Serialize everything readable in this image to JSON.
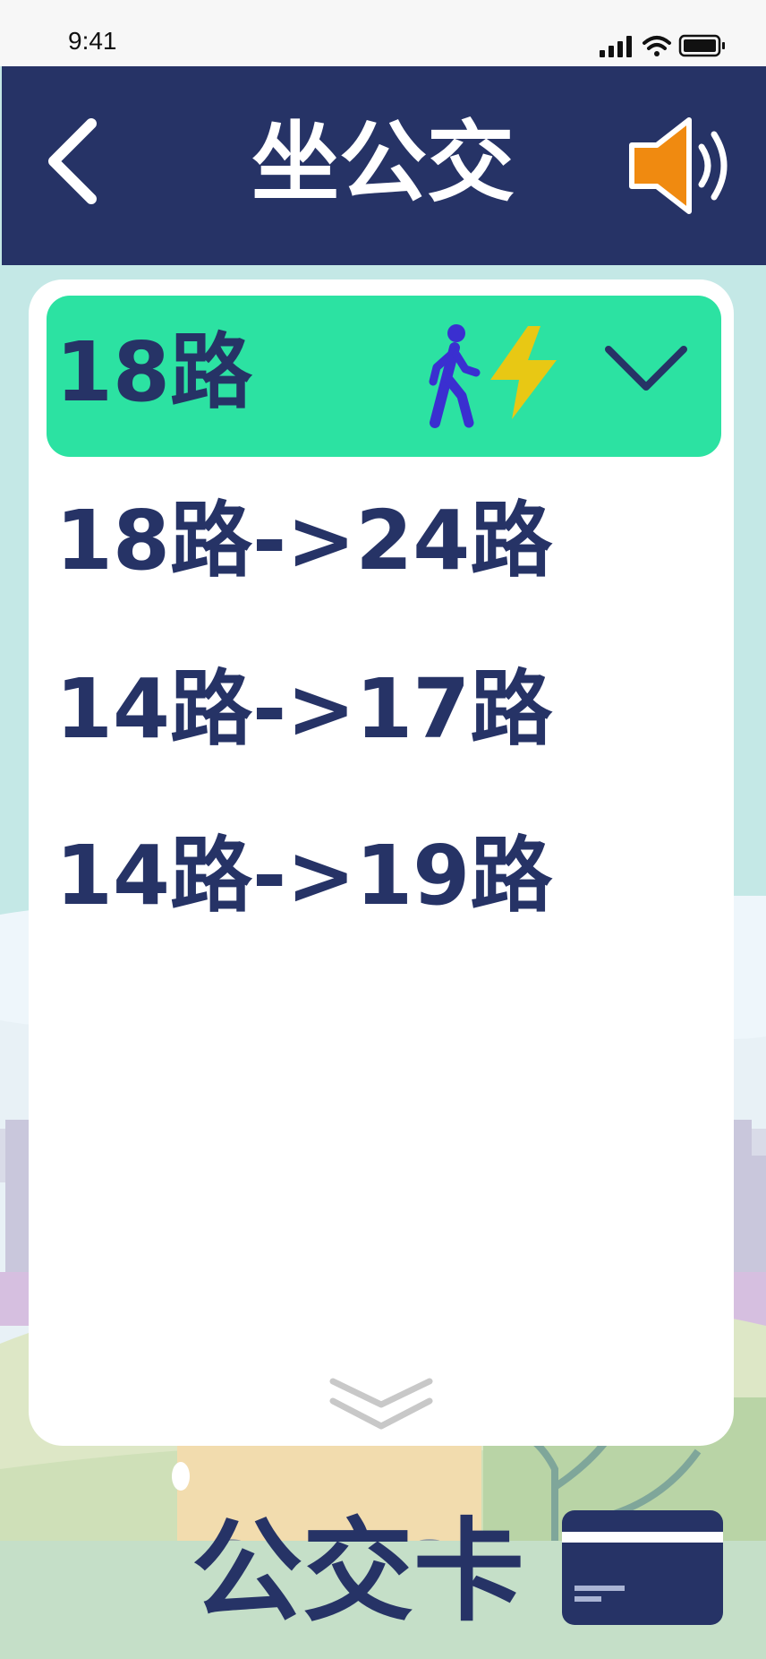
{
  "status_bar": {
    "time": "9:41"
  },
  "header": {
    "title": "坐公交"
  },
  "routes": {
    "selected": "18路",
    "items": [
      "18路->24路",
      "14路->17路",
      "14路->19路"
    ]
  },
  "footer": {
    "bus_card_label": "公交卡"
  },
  "colors": {
    "header_bg": "#263366",
    "selected_bg": "#2ce2a2",
    "text": "#263366",
    "speaker": "#f08a10",
    "bolt": "#e8c814",
    "walker": "#3a2fd0"
  },
  "icons": {
    "back": "chevron-left-icon",
    "sound": "speaker-icon",
    "walk": "walking-person-icon",
    "fast": "lightning-bolt-icon",
    "expand": "chevron-down-icon",
    "more": "double-chevron-down-icon",
    "card": "card-icon"
  }
}
